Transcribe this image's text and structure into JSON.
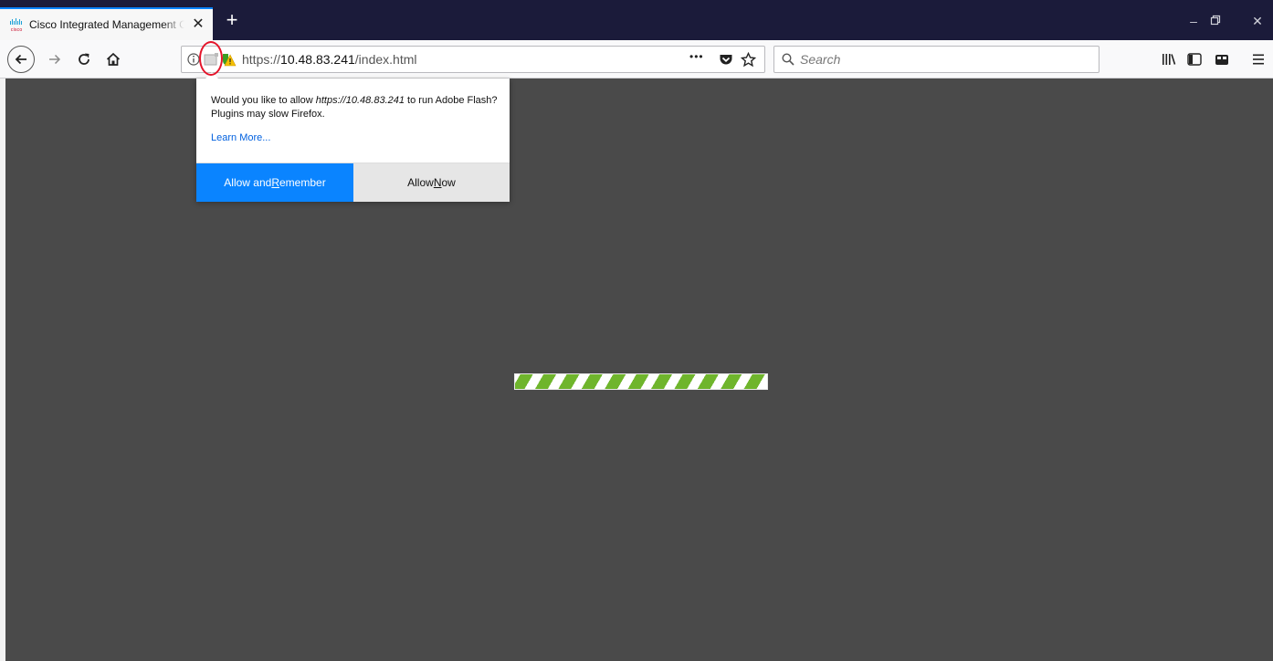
{
  "tab": {
    "title": "Cisco Integrated Management Controller",
    "close_glyph": "✕",
    "new_tab_glyph": "+"
  },
  "window_controls": {
    "minimize": "–",
    "restore": "❐",
    "close": "✕"
  },
  "urlbar": {
    "scheme": "https://",
    "host": "10.48.83.241",
    "path": "/index.html"
  },
  "page_actions": {
    "more": "•••"
  },
  "search": {
    "placeholder": "Search"
  },
  "doorhanger": {
    "message_prefix": "Would you like to allow ",
    "message_site": "https://10.48.83.241",
    "message_suffix": " to run Adobe Flash? Plugins may slow Firefox.",
    "learn_more": "Learn More...",
    "primary": {
      "before": "Allow and ",
      "access_key": "R",
      "after": "emember"
    },
    "secondary": {
      "before": "Allow ",
      "access_key": "N",
      "after": "ow"
    }
  },
  "icons": [
    "cisco-favicon",
    "back-icon",
    "forward-icon",
    "reload-icon",
    "home-icon",
    "info-icon",
    "plugin-icon",
    "warning-icon",
    "more-icon",
    "pocket-icon",
    "bookmark-star-icon",
    "search-icon",
    "library-icon",
    "sidebar-icon",
    "extension-icon",
    "menu-icon"
  ],
  "colors": {
    "tab_strip": "#1b1b3a",
    "accent": "#0a84ff",
    "content_bg": "#4a4a4a",
    "progress_green": "#6fb52c",
    "annotation_red": "#e4142a"
  }
}
